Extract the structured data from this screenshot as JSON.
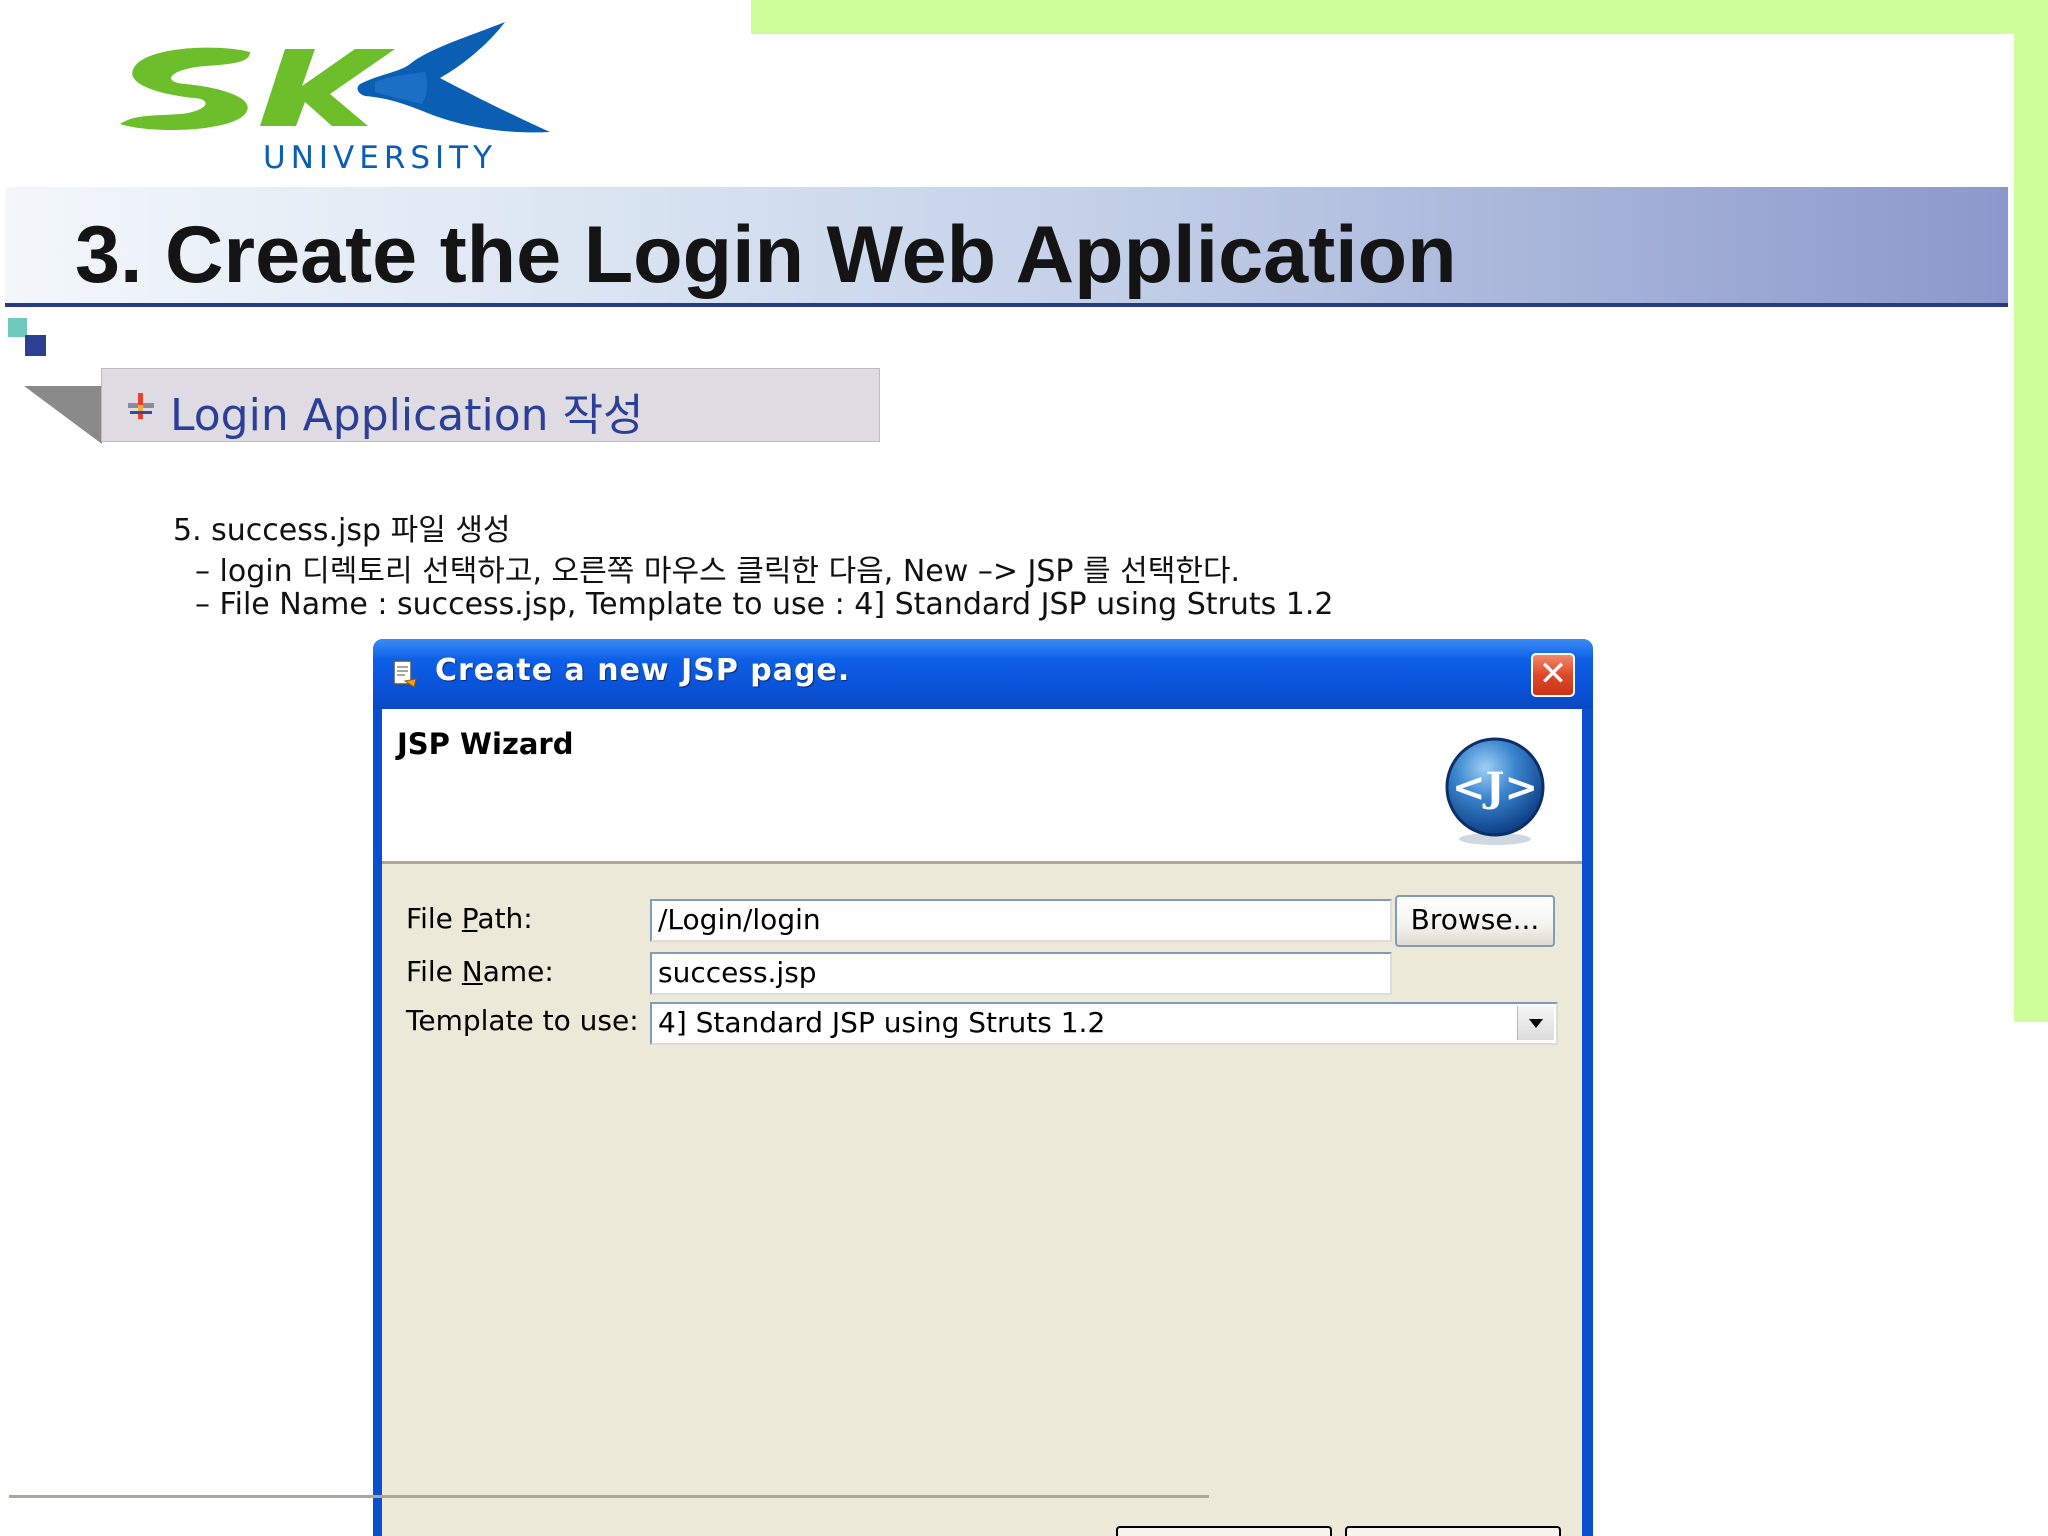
{
  "logo": {
    "word": "UNIVERSITY",
    "icon": "skk-logo-icon"
  },
  "slide": {
    "title": "3. Create the Login Web Application",
    "section_title": "Login Application 작성",
    "lines": [
      "5. success.jsp 파일 생성",
      "– login 디렉토리 선택하고, 오른쪽 마우스 클릭한 다음, New –> JSP 를 선택한다.",
      "– File Name : success.jsp, Template to use : 4] Standard JSP using Struts 1.2"
    ]
  },
  "dialog": {
    "title": "Create a new JSP page.",
    "close_label": "✕",
    "wizard_title": "JSP Wizard",
    "file_path": {
      "label_pre": "File ",
      "label_mnemonic": "P",
      "label_post": "ath:",
      "value": "/Login/login"
    },
    "browse_label": "Browse...",
    "file_name": {
      "label_pre": "File ",
      "label_mnemonic": "N",
      "label_post": "ame:",
      "value": "success.jsp"
    },
    "template": {
      "label": "Template to use:",
      "value": "4] Standard JSP using Struts 1.2"
    }
  },
  "colors": {
    "accent_green": "#ccff99",
    "title_blue": "#2b3f98",
    "logo_green": "#6cbf2b",
    "logo_blue": "#0a5fb4",
    "xp_title_blue": "#0a52d8"
  }
}
